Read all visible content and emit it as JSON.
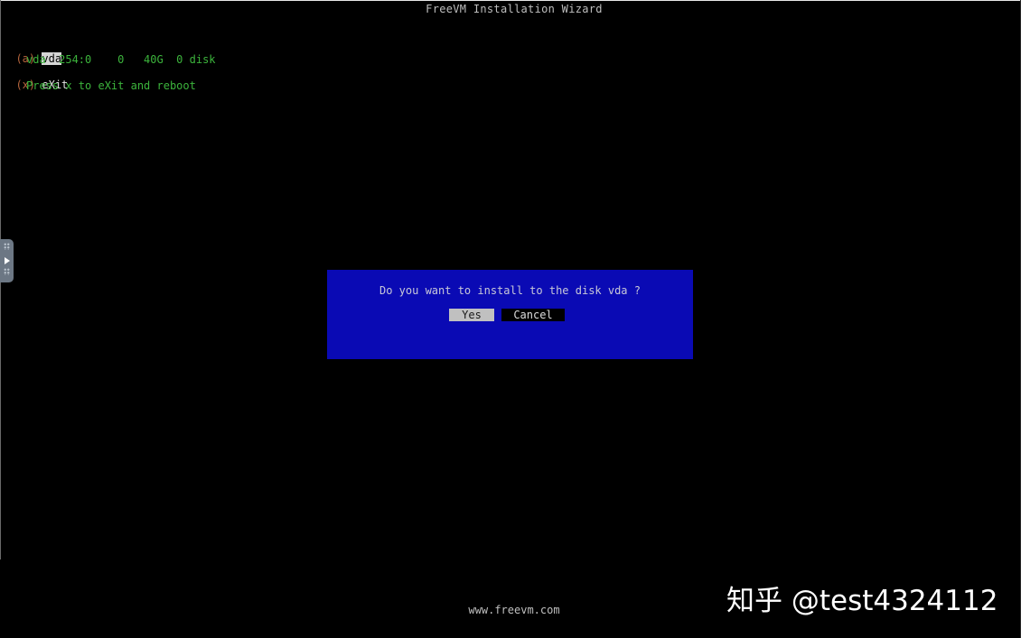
{
  "window": {
    "title": "FreeVM Installation Wizard"
  },
  "menu": {
    "option_a": {
      "key": "(a)",
      "label": "vda",
      "detail": "vda  254:0    0   40G  0 disk"
    },
    "option_x": {
      "key": "(x)",
      "label": "eXit",
      "detail": "Press x to eXit and reboot"
    }
  },
  "dialog": {
    "message": "Do you want to install to the disk vda ?",
    "yes_label": "Yes",
    "cancel_label": "Cancel"
  },
  "footer": {
    "url": "www.freevm.com"
  },
  "watermark": {
    "text": "知乎 @test4324112"
  },
  "colors": {
    "dialog_bg": "#0a0ab4",
    "key": "#b4643c",
    "detail": "#3cb43c"
  },
  "icons": {
    "side_handle": "expand-arrow-icon"
  }
}
